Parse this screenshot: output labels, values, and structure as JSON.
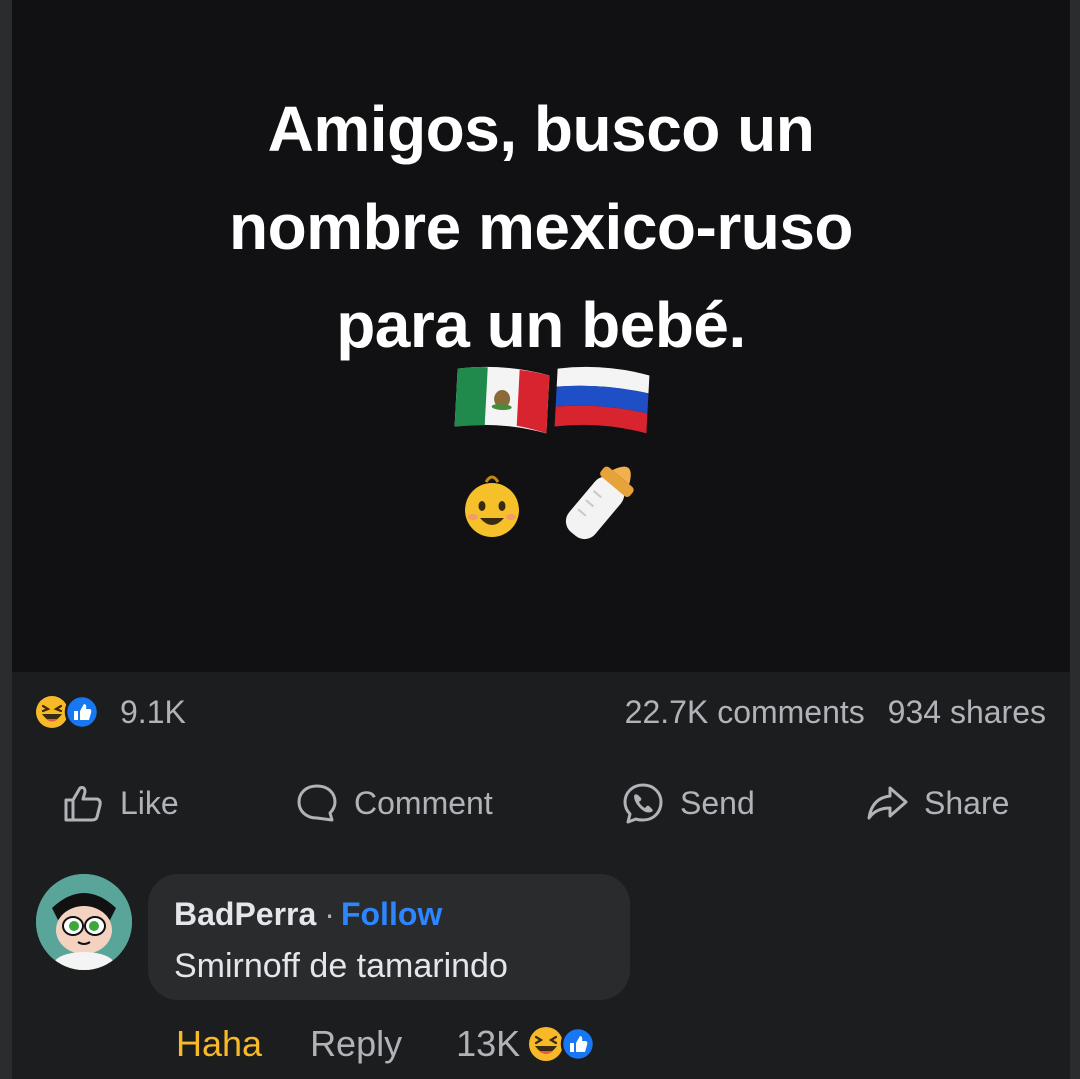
{
  "post": {
    "text_lines": [
      "Amigos, busco un",
      "nombre mexico-ruso",
      "para un bebé."
    ],
    "emoji_row1": [
      "mexico-flag",
      "russia-flag"
    ],
    "emoji_row2": [
      "baby-face",
      "baby-bottle"
    ]
  },
  "stats": {
    "reaction_icons": [
      "haha-icon",
      "like-icon"
    ],
    "reaction_count": "9.1K",
    "comments": "22.7K comments",
    "shares": "934 shares"
  },
  "actions": {
    "like": "Like",
    "comment": "Comment",
    "send": "Send",
    "share": "Share"
  },
  "comment": {
    "author": "BadPerra",
    "separator": "·",
    "follow": "Follow",
    "text": "Smirnoff de tamarindo",
    "haha": "Haha",
    "reply": "Reply",
    "reaction_count": "13K",
    "reaction_icons": [
      "haha-icon",
      "like-icon"
    ]
  },
  "colors": {
    "background": "#1c1d1f",
    "post_background": "#111113",
    "follow": "#2d86ff",
    "haha": "#f7b928",
    "muted_text": "#b0b3b8"
  }
}
